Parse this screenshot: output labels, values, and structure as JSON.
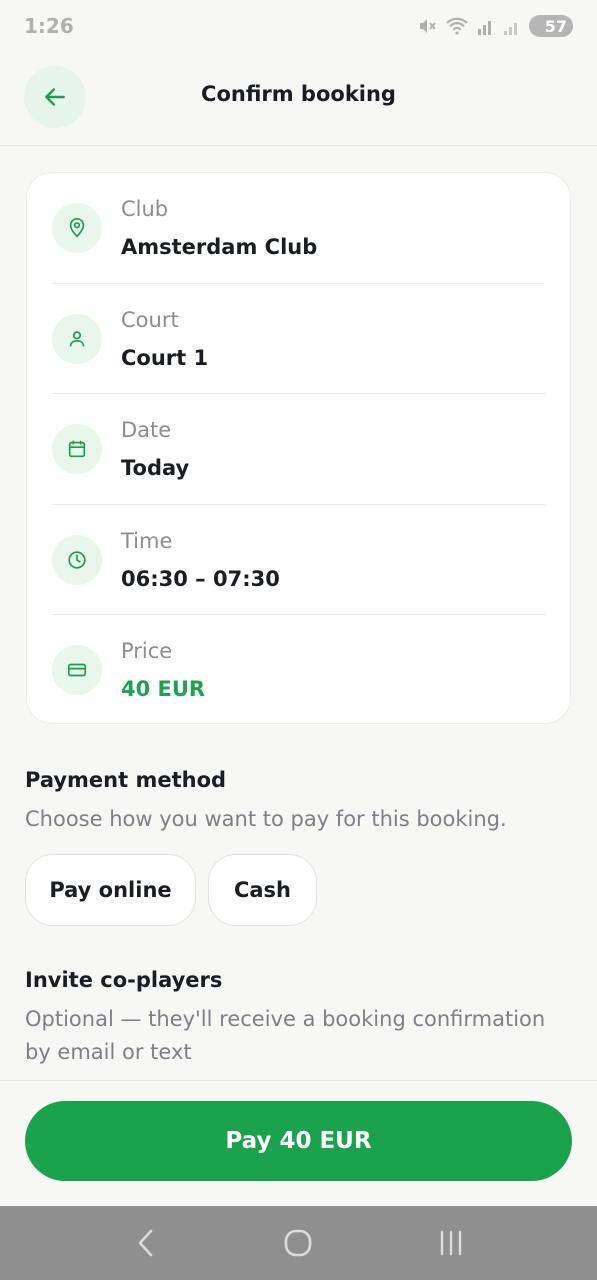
{
  "status_bar": {
    "time": "1:26",
    "battery": "57"
  },
  "header": {
    "title": "Confirm booking"
  },
  "details": [
    {
      "label": "Club",
      "value": "Amsterdam Club",
      "icon": "location-pin-icon"
    },
    {
      "label": "Court",
      "value": "Court 1",
      "icon": "person-icon"
    },
    {
      "label": "Date",
      "value": "Today",
      "icon": "calendar-icon"
    },
    {
      "label": "Time",
      "value": "06:30 – 07:30",
      "icon": "clock-icon"
    },
    {
      "label": "Price",
      "value": "40 EUR",
      "icon": "credit-card-icon"
    }
  ],
  "payment": {
    "title": "Payment method",
    "description": "Choose how you want to pay for this booking.",
    "options": [
      "Pay online",
      "Cash"
    ]
  },
  "invite": {
    "title": "Invite co-players",
    "description": "Optional — they'll receive a booking confirmation by email or text"
  },
  "footer": {
    "pay_label": "Pay 40 EUR"
  },
  "colors": {
    "accent": "#1aa24c",
    "accent_light": "#e6f5eb",
    "price": "#1fa24f"
  }
}
